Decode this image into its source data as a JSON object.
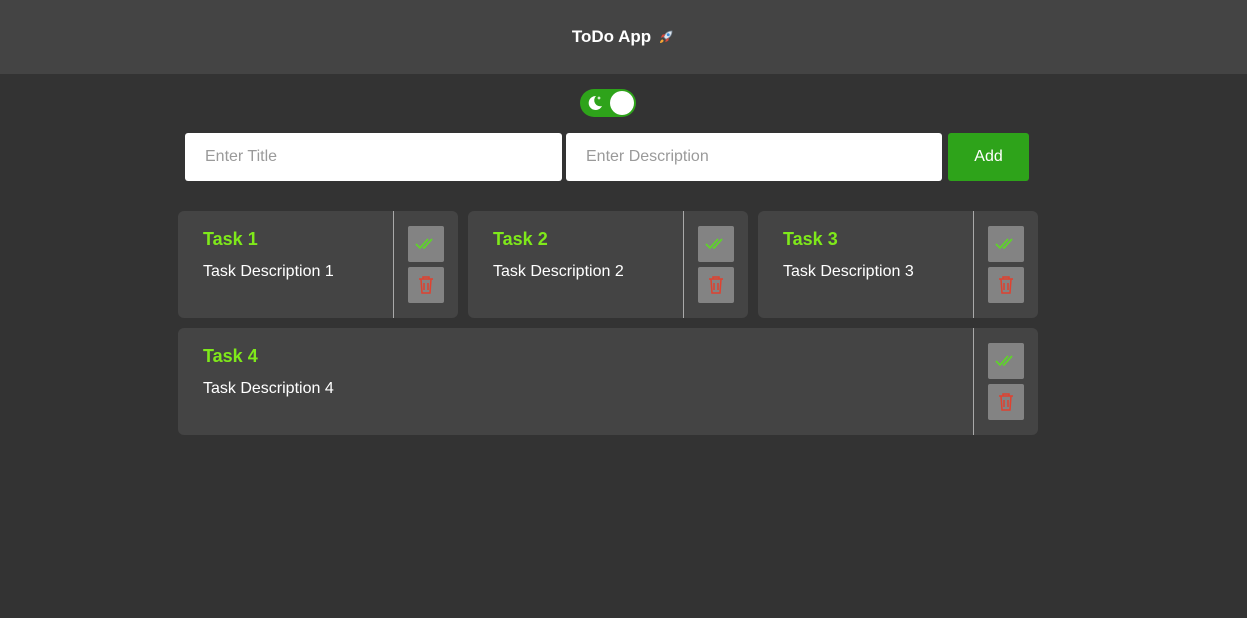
{
  "header": {
    "title": "ToDo App",
    "title_emoji": "rocket-icon"
  },
  "theme_toggle": {
    "icon": "moon-icon",
    "state": "dark",
    "accent": "#2ea31a"
  },
  "form": {
    "title_placeholder": "Enter Title",
    "description_placeholder": "Enter Description",
    "title_value": "",
    "description_value": "",
    "add_label": "Add"
  },
  "tasks": [
    {
      "title": "Task 1",
      "description": "Task Description 1"
    },
    {
      "title": "Task 2",
      "description": "Task Description 2"
    },
    {
      "title": "Task 3",
      "description": "Task Description 3"
    },
    {
      "title": "Task 4",
      "description": "Task Description 4"
    }
  ],
  "colors": {
    "background": "#333333",
    "header": "#444444",
    "card": "#444444",
    "task_title": "#7fe91a",
    "check": "#5fd32b",
    "delete": "#e0412f"
  }
}
